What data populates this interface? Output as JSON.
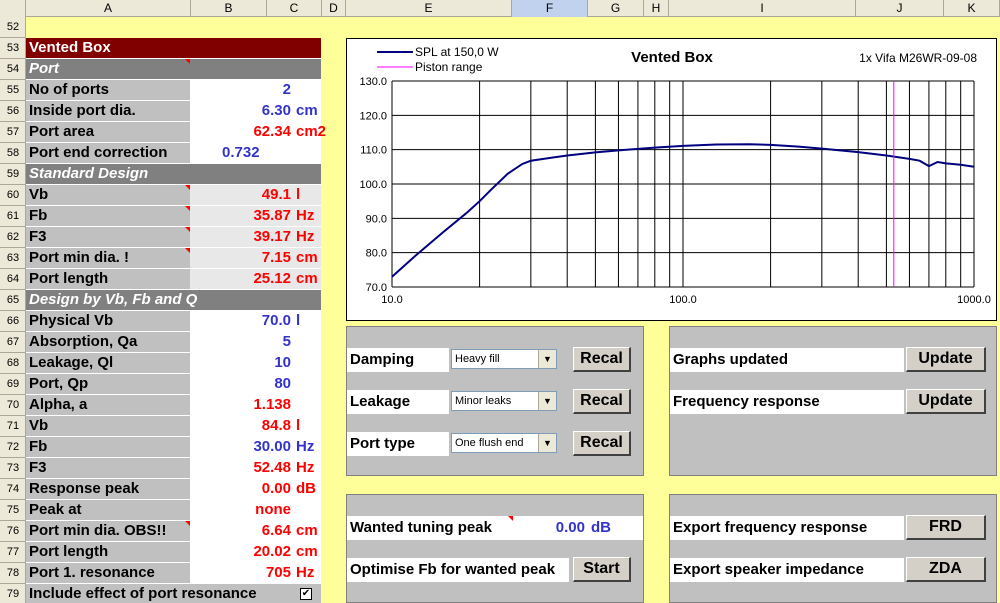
{
  "columns": [
    "A",
    "B",
    "C",
    "D",
    "E",
    "F",
    "G",
    "H",
    "I",
    "J",
    "K"
  ],
  "rows": [
    "52",
    "53",
    "54",
    "55",
    "56",
    "57",
    "58",
    "59",
    "60",
    "61",
    "62",
    "63",
    "64",
    "65",
    "66",
    "67",
    "68",
    "69",
    "70",
    "71",
    "72",
    "73",
    "74",
    "75",
    "76",
    "77",
    "78",
    "79"
  ],
  "left_table": {
    "title": "Vented Box",
    "port_header": "Port",
    "no_of_ports": {
      "label": "No of ports",
      "value": "2",
      "unit": ""
    },
    "inside_port_dia": {
      "label": "Inside port dia.",
      "value": "6.30",
      "unit": "cm"
    },
    "port_area": {
      "label": "Port area",
      "value": "62.34",
      "unit": "cm2"
    },
    "port_end_correction": {
      "label": "Port end correction",
      "value": "0.732",
      "unit": ""
    },
    "standard_header": "Standard Design",
    "vb": {
      "label": "Vb",
      "value": "49.1",
      "unit": "l"
    },
    "fb": {
      "label": "Fb",
      "value": "35.87",
      "unit": "Hz"
    },
    "f3": {
      "label": "F3",
      "value": "39.17",
      "unit": "Hz"
    },
    "port_min_dia": {
      "label": "Port min dia. !",
      "value": "7.15",
      "unit": "cm"
    },
    "port_length": {
      "label": "Port length",
      "value": "25.12",
      "unit": "cm"
    },
    "design_header": "Design by Vb, Fb and Q",
    "physical_vb": {
      "label": "Physical Vb",
      "value": "70.0",
      "unit": "l"
    },
    "absorption": {
      "label": "Absorption, Qa",
      "value": "5",
      "unit": ""
    },
    "leakage": {
      "label": "Leakage, Ql",
      "value": "10",
      "unit": ""
    },
    "port_qp": {
      "label": "Port, Qp",
      "value": "80",
      "unit": ""
    },
    "alpha": {
      "label": "Alpha, a",
      "value": "1.138",
      "unit": ""
    },
    "vb2": {
      "label": "Vb",
      "value": "84.8",
      "unit": "l"
    },
    "fb2": {
      "label": "Fb",
      "value": "30.00",
      "unit": "Hz"
    },
    "f3_2": {
      "label": "F3",
      "value": "52.48",
      "unit": "Hz"
    },
    "response_peak": {
      "label": "Response peak",
      "value": "0.00",
      "unit": "dB"
    },
    "peak_at": {
      "label": "Peak at",
      "value": "none",
      "unit": ""
    },
    "port_min_dia_obs": {
      "label": "Port min dia. OBS!!",
      "value": "6.64",
      "unit": "cm"
    },
    "port_length2": {
      "label": "Port length",
      "value": "20.02",
      "unit": "cm"
    },
    "port_resonance": {
      "label": "Port 1. resonance",
      "value": "705",
      "unit": "Hz"
    },
    "include_effect": {
      "label": "Include effect of port resonance",
      "checked": "✔"
    }
  },
  "chart_data": {
    "type": "line",
    "title": "Vented Box",
    "subtitle": "1x Vifa M26WR-09-08",
    "x_scale": "log",
    "xlim": [
      10,
      1000
    ],
    "ylim": [
      70,
      130
    ],
    "x_ticks": [
      "10.0",
      "100.0",
      "1000.0"
    ],
    "y_ticks": [
      "70.0",
      "80.0",
      "90.0",
      "100.0",
      "110.0",
      "120.0",
      "130.0"
    ],
    "grid": true,
    "legend_position": "top-left",
    "series": [
      {
        "name": "SPL at 150,0 W",
        "color": "#000080",
        "x": [
          10,
          12,
          15,
          18,
          20,
          22,
          25,
          28,
          30,
          35,
          40,
          50,
          60,
          80,
          100,
          130,
          170,
          200,
          250,
          300,
          400,
          500,
          600,
          650,
          700,
          750,
          800,
          900,
          1000
        ],
        "y": [
          73.0,
          79.0,
          86.0,
          91.5,
          95.0,
          98.5,
          103.0,
          105.8,
          106.8,
          107.6,
          108.3,
          109.2,
          109.8,
          110.6,
          111.1,
          111.5,
          111.6,
          111.4,
          110.9,
          110.3,
          109.3,
          108.3,
          107.3,
          106.8,
          105.2,
          106.4,
          106.0,
          105.6,
          105.0
        ]
      },
      {
        "name": "Piston range",
        "color": "#ff00ff",
        "x": [
          530,
          530
        ],
        "y": [
          70,
          130
        ]
      }
    ]
  },
  "panel1": {
    "damping": {
      "label": "Damping",
      "option": "Heavy fill",
      "button": "Recal"
    },
    "leakage": {
      "label": "Leakage",
      "option": "Minor leaks",
      "button": "Recal"
    },
    "port_type": {
      "label": "Port type",
      "option": "One flush end",
      "button": "Recal"
    }
  },
  "panel2": {
    "graphs_updated": {
      "label": "Graphs updated",
      "button": "Update"
    },
    "frequency_response": {
      "label": "Frequency response",
      "button": "Update"
    }
  },
  "panel3": {
    "wanted_tuning_peak": {
      "label": "Wanted tuning peak",
      "value": "0.00",
      "unit": "dB"
    },
    "optimise": {
      "label": "Optimise Fb for wanted peak",
      "button": "Start"
    }
  },
  "panel4": {
    "export_frd": {
      "label": "Export frequency response",
      "button": "FRD"
    },
    "export_zda": {
      "label": "Export speaker impedance",
      "button": "ZDA"
    }
  }
}
